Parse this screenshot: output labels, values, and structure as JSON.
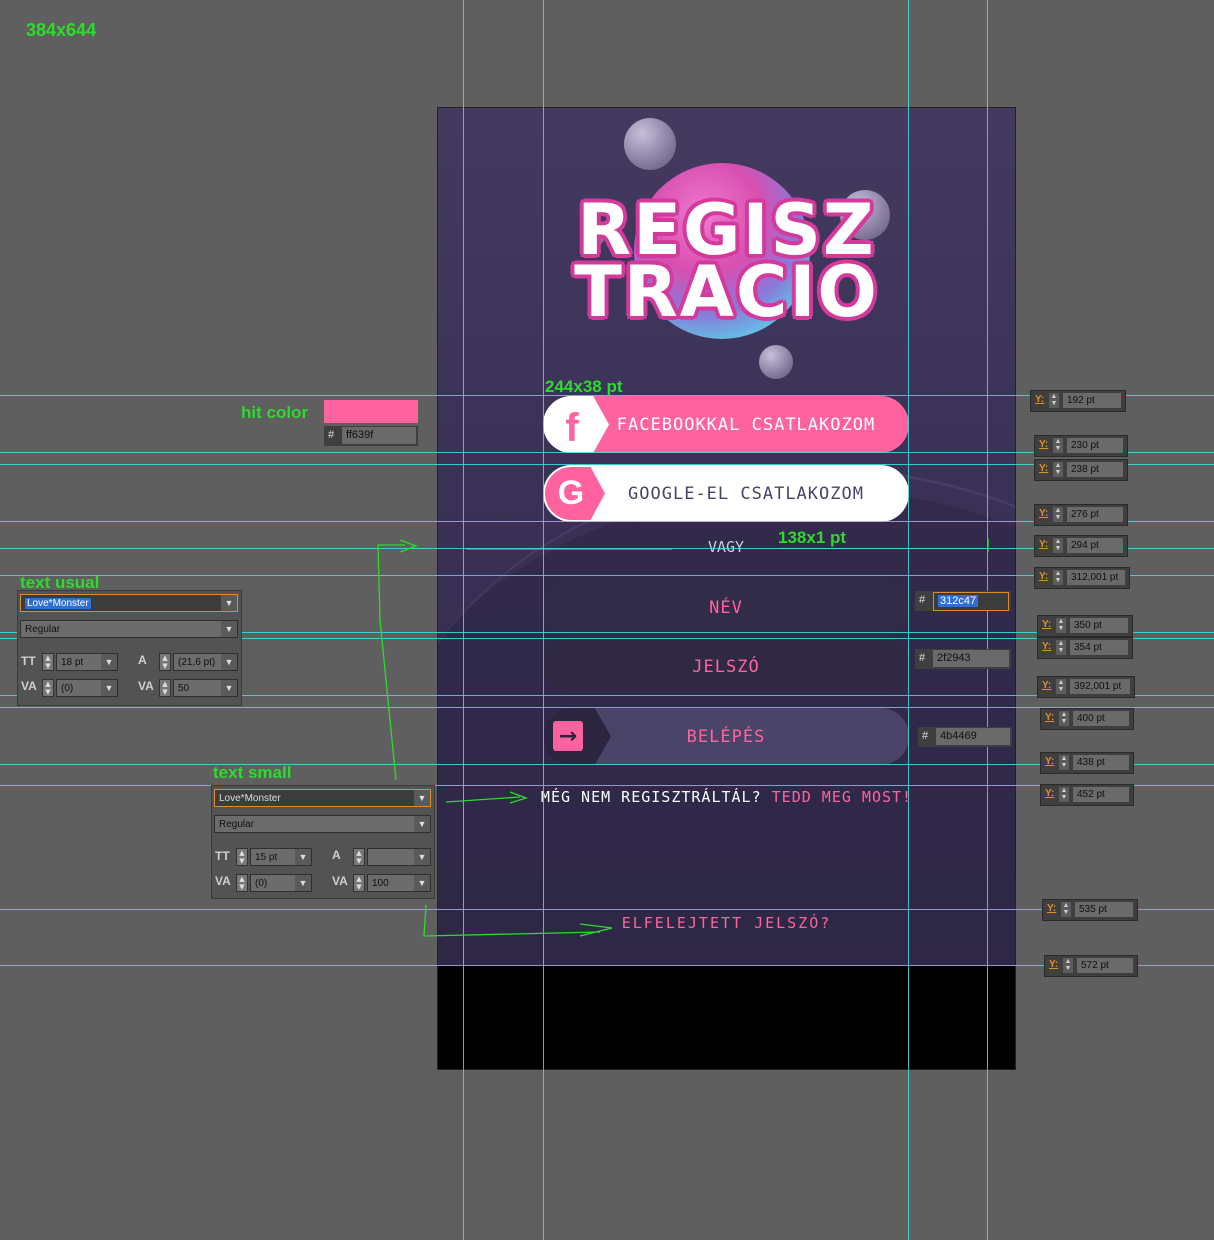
{
  "canvas_label": "384x644",
  "app": {
    "logo_line1": "REGISZ",
    "logo_line2": "TRACIO",
    "facebook_button": "FACEBOOKKAL CSATLAKOZOM",
    "facebook_icon": "f",
    "google_button": "GOOGLE-EL CSATLAKOZOM",
    "google_icon": "G",
    "or_text": "VAGY",
    "name_field": "NÉV",
    "password_field": "JELSZÓ",
    "login_button": "BELÉPÉS",
    "login_icon": "→",
    "register_question": "MÉG NEM REGISZTRÁLTÁL?",
    "register_link": "TEDD MEG MOST!",
    "forgot_link": "ELFELEJTETT JELSZÓ?"
  },
  "annotations": {
    "button_size": "244x38 pt",
    "divider_size": "138x1 pt",
    "hit_color_label": "hit color",
    "hit_color_hex": "ff639f",
    "text_usual_label": "text usual",
    "text_small_label": "text small",
    "field_colors": {
      "name": "312c47",
      "password": "2f2943",
      "login": "4b4469"
    }
  },
  "text_usual_panel": {
    "font": "Love*Monster",
    "style": "Regular",
    "size": "18 pt",
    "leading": "(21,6 pt)",
    "kerning": "(0)",
    "tracking": "50"
  },
  "text_small_panel": {
    "font": "Love*Monster",
    "style": "Regular",
    "size": "15 pt",
    "leading": "",
    "kerning": "(0)",
    "tracking": "100"
  },
  "y_guides": [
    "192 pt",
    "230 pt",
    "238 pt",
    "276 pt",
    "294 pt",
    "312,001 pt",
    "350 pt",
    "354 pt",
    "392,001 pt",
    "400 pt",
    "438 pt",
    "452 pt",
    "535 pt",
    "572 pt"
  ],
  "colors": {
    "pink": "#ff639f",
    "name_field": "#312c47",
    "password_field": "#2f2943",
    "login": "#4b4469"
  }
}
